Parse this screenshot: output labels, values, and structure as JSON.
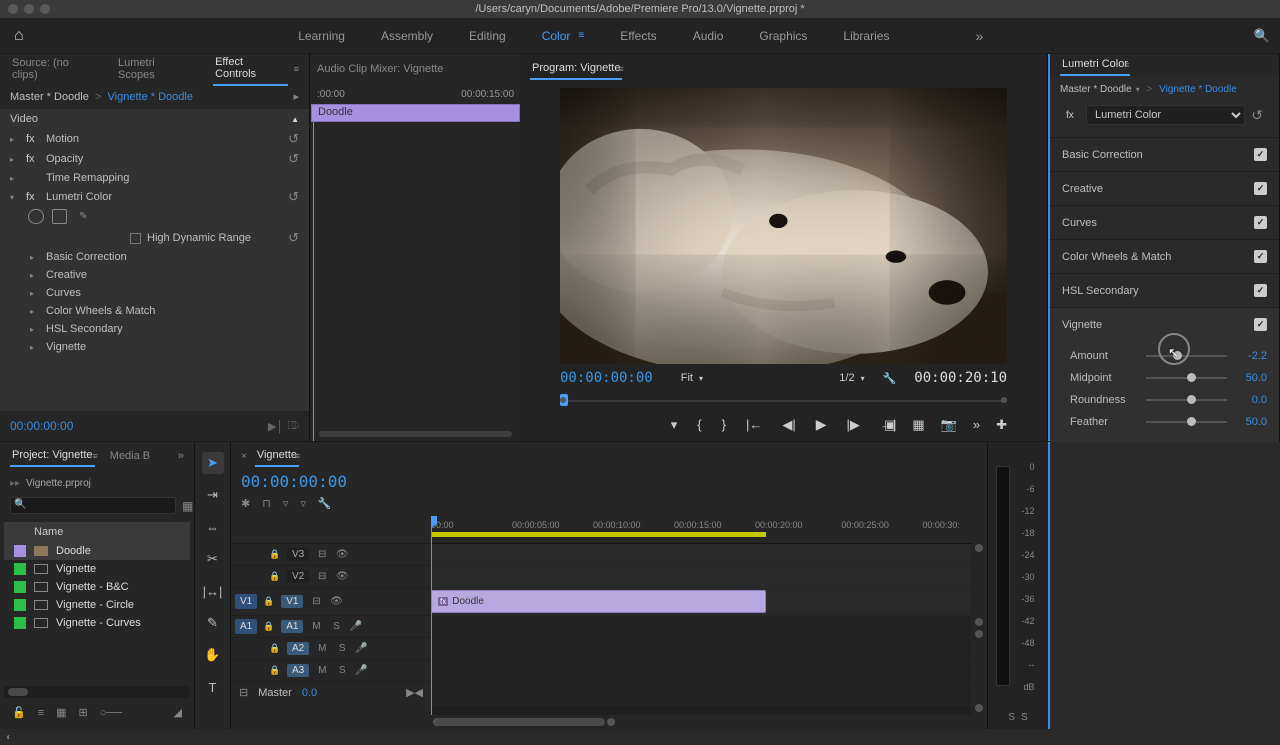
{
  "titlebar": {
    "path": "/Users/caryn/Documents/Adobe/Premiere Pro/13.0/Vignette.prproj *"
  },
  "workspaces": {
    "items": [
      "Learning",
      "Assembly",
      "Editing",
      "Color",
      "Effects",
      "Audio",
      "Graphics",
      "Libraries"
    ],
    "active": "Color"
  },
  "source_tabs": {
    "source": "Source: (no clips)",
    "scopes": "Lumetri Scopes",
    "effect_controls": "Effect Controls",
    "audio_mixer": "Audio Clip Mixer: Vignette"
  },
  "effect_controls": {
    "master": "Master * Doodle",
    "clip_link": "Vignette * Doodle",
    "mini_tl": {
      "start": ":00:00",
      "end": "00:00:15:00",
      "clip": "Doodle"
    },
    "video_label": "Video",
    "effects": {
      "motion": "Motion",
      "opacity": "Opacity",
      "time_remap": "Time Remapping",
      "lumetri": "Lumetri Color",
      "hdr_label": "High Dynamic Range",
      "subs": [
        "Basic Correction",
        "Creative",
        "Curves",
        "Color Wheels & Match",
        "HSL Secondary",
        "Vignette"
      ]
    },
    "timecode": "00:00:00:00"
  },
  "program": {
    "tab": "Program: Vignette",
    "tc_left": "00:00:00:00",
    "fit": "Fit",
    "scale": "1/2",
    "tc_right": "00:00:20:10"
  },
  "lumetri": {
    "title": "Lumetri Color",
    "master": "Master * Doodle",
    "clip_link": "Vignette * Doodle",
    "fx_name": "Lumetri Color",
    "sections": {
      "basic": "Basic Correction",
      "creative": "Creative",
      "curves": "Curves",
      "wheels": "Color Wheels & Match",
      "hsl": "HSL Secondary",
      "vignette": "Vignette"
    },
    "vignette_sliders": {
      "amount": {
        "label": "Amount",
        "value": "-2.2",
        "pos": 33
      },
      "midpoint": {
        "label": "Midpoint",
        "value": "50.0",
        "pos": 50
      },
      "roundness": {
        "label": "Roundness",
        "value": "0.0",
        "pos": 50
      },
      "feather": {
        "label": "Feather",
        "value": "50.0",
        "pos": 50
      }
    }
  },
  "project": {
    "tab": "Project: Vignette",
    "tab2": "Media B",
    "file": "Vignette.prproj",
    "list_header": "Name",
    "items": [
      {
        "name": "Doodle",
        "color": "#a890e0",
        "type": "bin",
        "selected": true
      },
      {
        "name": "Vignette",
        "color": "#2bbf4a",
        "type": "seq",
        "selected": false
      },
      {
        "name": "Vignette - B&C",
        "color": "#2bbf4a",
        "type": "seq",
        "selected": false
      },
      {
        "name": "Vignette - Circle",
        "color": "#2bbf4a",
        "type": "seq",
        "selected": false
      },
      {
        "name": "Vignette - Curves",
        "color": "#2bbf4a",
        "type": "seq",
        "selected": false
      }
    ]
  },
  "timeline": {
    "tab": "Vignette",
    "tc": "00:00:00:00",
    "ruler": [
      "00:00",
      "00:00:05:00",
      "00:00:10:00",
      "00:00:15:00",
      "00:00:20:00",
      "00:00:25:00",
      "00:00:30:"
    ],
    "tracks": {
      "v3": "V3",
      "v2": "V2",
      "v1": "V1",
      "v1_patch": "V1",
      "a1": "A1",
      "a1_patch": "A1",
      "a2": "A2",
      "a3": "A3",
      "master": "Master",
      "master_val": "0.0"
    },
    "clip": {
      "name": "Doodle",
      "fx": "fx"
    },
    "toggles": {
      "m": "M",
      "s": "S"
    }
  },
  "meters": {
    "scale": [
      "0",
      "-6",
      "-12",
      "-18",
      "-24",
      "-30",
      "-36",
      "-42",
      "-48",
      "--",
      "dB"
    ],
    "solo": "S"
  }
}
